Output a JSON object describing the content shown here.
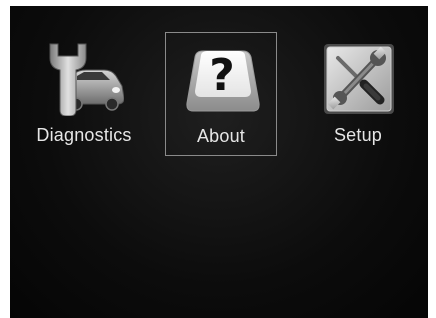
{
  "menu": {
    "items": [
      {
        "label": "Diagnostics",
        "icon": "car-wrench-icon"
      },
      {
        "label": "About",
        "icon": "question-key-icon",
        "selected": true
      },
      {
        "label": "Setup",
        "icon": "tools-settings-icon"
      }
    ]
  },
  "colors": {
    "background": "#0c0c0c",
    "label": "#e6e6e6",
    "selection_border": "#8a8a8a"
  }
}
